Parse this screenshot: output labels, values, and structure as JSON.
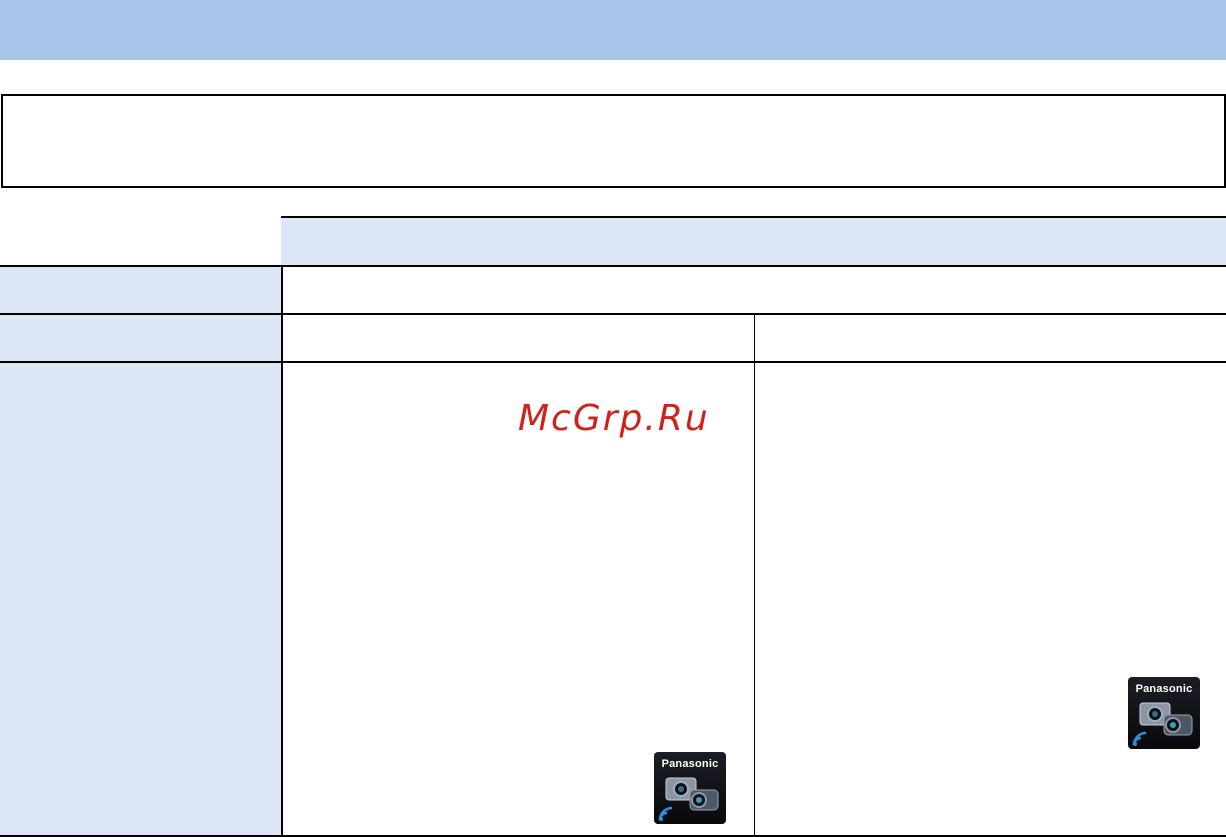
{
  "watermark": {
    "text": "McGrp.Ru",
    "color": "#d0211a"
  },
  "app_icons": [
    {
      "icon": "panasonic-image-app-icon",
      "brand": "Panasonic"
    },
    {
      "icon": "panasonic-image-app-icon",
      "brand": "Panasonic"
    }
  ],
  "colors": {
    "header_bar": "#abc5ea",
    "table_shade": "#dce6f6",
    "border": "#000000"
  }
}
